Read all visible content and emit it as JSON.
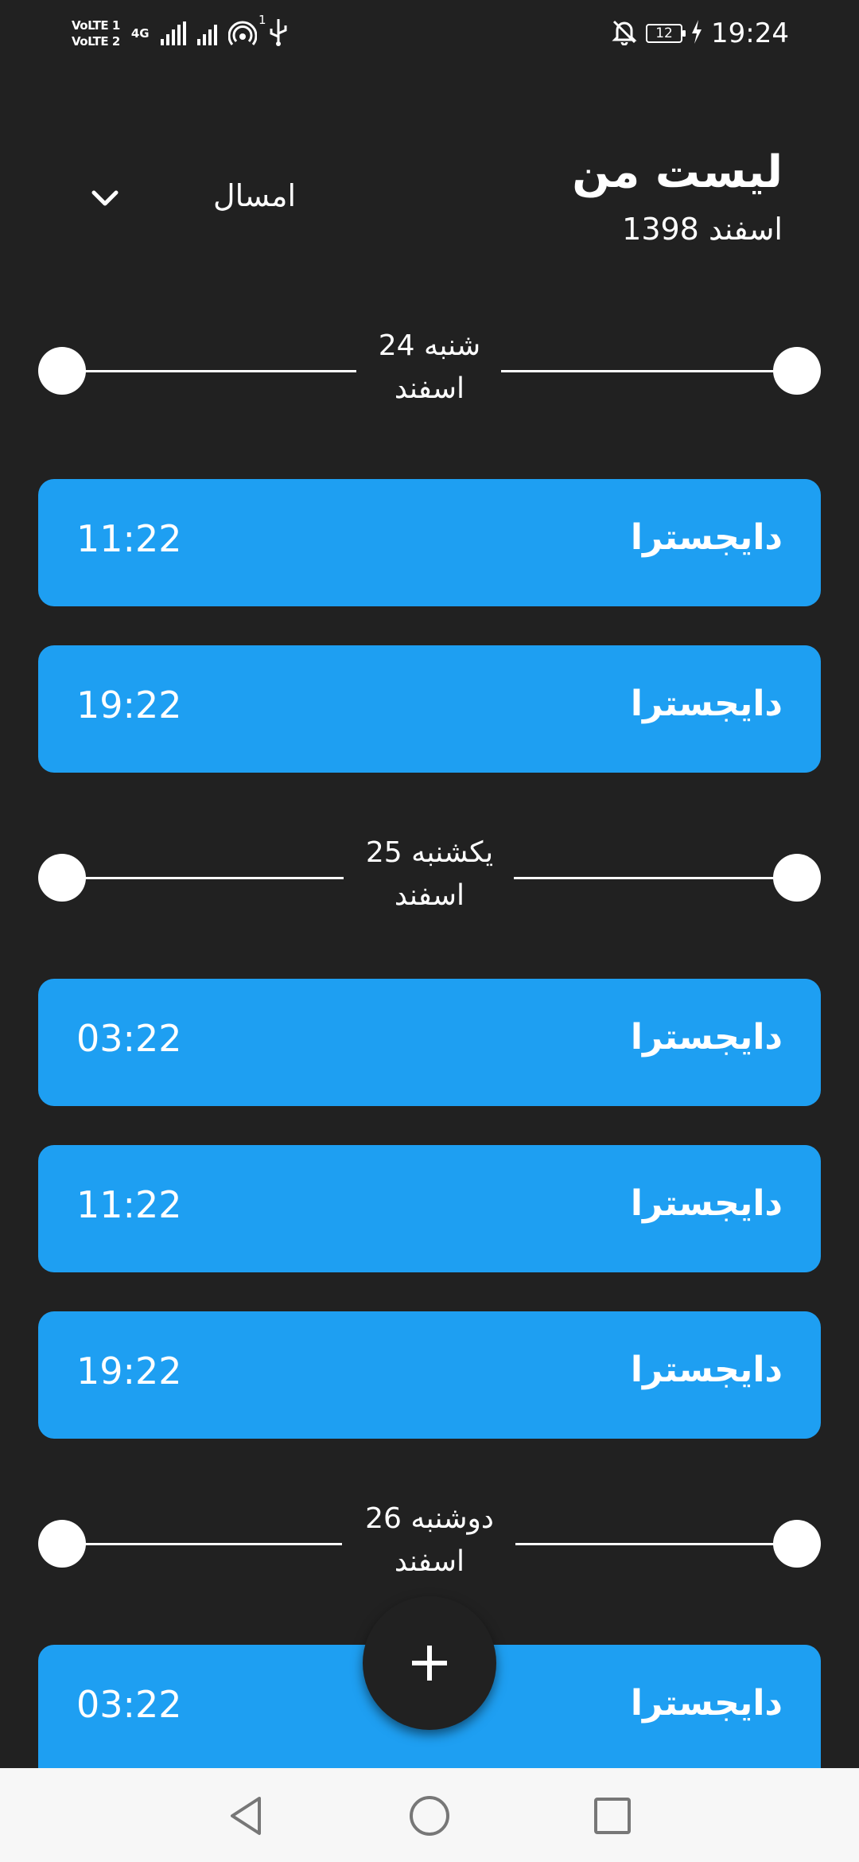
{
  "status_bar": {
    "volte_1": "VoLTE 1",
    "volte_2": "VoLTE 2",
    "network": "4G",
    "hotspot_count": "1",
    "battery": "12",
    "time": "19:24",
    "icons": [
      "signal-icon",
      "hotspot-icon",
      "usb-icon",
      "mute-bell-icon",
      "battery-icon",
      "charging-icon"
    ]
  },
  "header": {
    "title": "لیست من",
    "subtitle": "اسفند 1398",
    "year_filter": "امسال"
  },
  "days": [
    {
      "label_line1": "شنبه 24",
      "label_line2": "اسفند",
      "tasks": [
        {
          "name": "دایجسترا",
          "time": "11:22"
        },
        {
          "name": "دایجسترا",
          "time": "19:22"
        }
      ]
    },
    {
      "label_line1": "یکشنبه 25",
      "label_line2": "اسفند",
      "tasks": [
        {
          "name": "دایجسترا",
          "time": "03:22"
        },
        {
          "name": "دایجسترا",
          "time": "11:22"
        },
        {
          "name": "دایجسترا",
          "time": "19:22"
        }
      ]
    },
    {
      "label_line1": "دوشنبه 26",
      "label_line2": "اسفند",
      "tasks": [
        {
          "name": "دایجسترا",
          "time": "03:22"
        }
      ]
    }
  ],
  "colors": {
    "background": "#212121",
    "card": "#1e9ff2",
    "text": "#ffffff",
    "navbar": "#f7f7f7"
  }
}
